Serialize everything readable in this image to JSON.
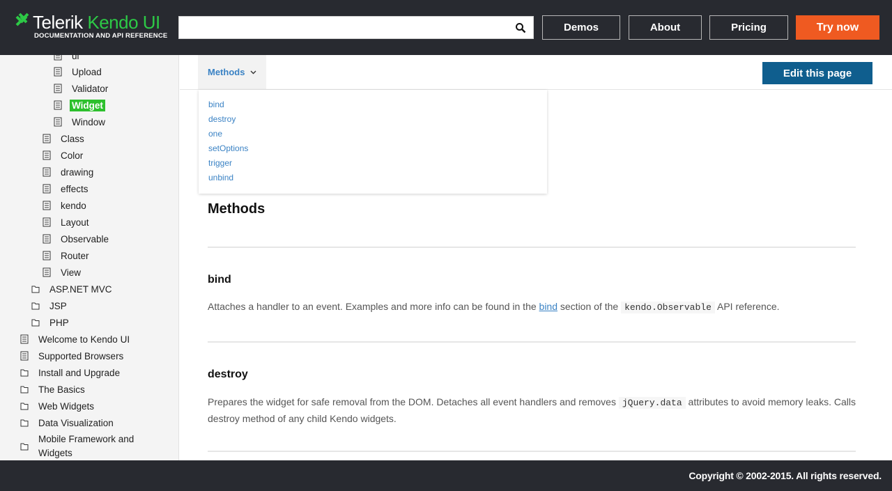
{
  "header": {
    "logo_brand": "Telerik",
    "logo_product": "Kendo UI",
    "logo_subtitle": "DOCUMENTATION AND API REFERENCE",
    "search_value": "",
    "search_placeholder": "",
    "nav": {
      "demos": "Demos",
      "about": "About",
      "pricing": "Pricing",
      "try_now": "Try now"
    }
  },
  "sidebar": {
    "items": [
      {
        "label": "ui",
        "icon": "document-icon"
      },
      {
        "label": "Upload",
        "icon": "document-icon"
      },
      {
        "label": "Validator",
        "icon": "document-icon"
      },
      {
        "label": "Widget",
        "icon": "document-icon",
        "selected": true
      },
      {
        "label": "Window",
        "icon": "document-icon"
      },
      {
        "label": "Class",
        "icon": "document-icon"
      },
      {
        "label": "Color",
        "icon": "document-icon"
      },
      {
        "label": "drawing",
        "icon": "document-icon"
      },
      {
        "label": "effects",
        "icon": "document-icon"
      },
      {
        "label": "kendo",
        "icon": "document-icon"
      },
      {
        "label": "Layout",
        "icon": "document-icon"
      },
      {
        "label": "Observable",
        "icon": "document-icon"
      },
      {
        "label": "Router",
        "icon": "document-icon"
      },
      {
        "label": "View",
        "icon": "document-icon"
      },
      {
        "label": "ASP.NET MVC",
        "icon": "folder-icon"
      },
      {
        "label": "JSP",
        "icon": "folder-icon"
      },
      {
        "label": "PHP",
        "icon": "folder-icon"
      },
      {
        "label": "Welcome to Kendo UI",
        "icon": "document-icon"
      },
      {
        "label": "Supported Browsers",
        "icon": "document-icon"
      },
      {
        "label": "Install and Upgrade",
        "icon": "folder-icon"
      },
      {
        "label": "The Basics",
        "icon": "folder-icon"
      },
      {
        "label": "Web Widgets",
        "icon": "folder-icon"
      },
      {
        "label": "Data Visualization",
        "icon": "folder-icon"
      },
      {
        "label": "Mobile Framework and Widgets",
        "icon": "folder-icon"
      }
    ]
  },
  "toolbar": {
    "methods_tab": "Methods",
    "edit_button": "Edit this page"
  },
  "dropdown": {
    "items": [
      "bind",
      "destroy",
      "one",
      "setOptions",
      "trigger",
      "unbind"
    ]
  },
  "content": {
    "heading": "Methods",
    "sections": [
      {
        "title": "bind",
        "text_before": "Attaches a handler to an event. Examples and more info can be found in the ",
        "link": "bind",
        "text_middle": " section of the ",
        "code": "kendo.Observable",
        "text_after": " API reference."
      },
      {
        "title": "destroy",
        "text_before": "Prepares the widget for safe removal from the DOM. Detaches all event handlers and removes ",
        "code": "jQuery.data",
        "text_after": " attributes to avoid memory leaks. Calls destroy method of any child Kendo widgets."
      }
    ]
  },
  "footer": {
    "copyright": "Copyright © 2002-2015. All rights reserved."
  },
  "colors": {
    "header_bg": "#282a30",
    "accent_green": "#2dc946",
    "try_now_orange": "#ef5a21",
    "edit_button_blue": "#0f5e8e",
    "link_blue": "#3a82c4"
  }
}
